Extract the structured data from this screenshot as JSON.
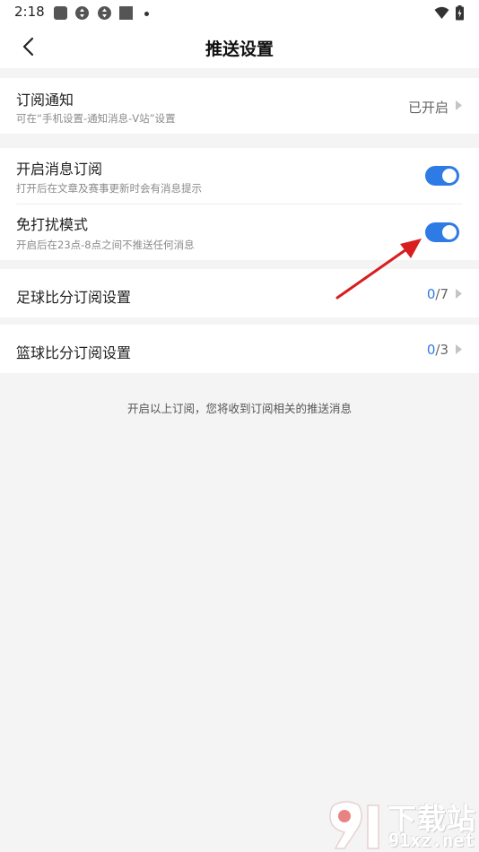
{
  "status_bar": {
    "time": "2:18",
    "icons": [
      "app-notification-icon",
      "sync-icon",
      "sync-icon",
      "stop-icon",
      "dot-icon",
      "wifi-icon",
      "battery-charging-icon"
    ]
  },
  "header": {
    "title": "推送设置",
    "back_icon": "chevron-left-icon"
  },
  "subscription_notice": {
    "title": "订阅通知",
    "subtitle": "可在“手机设置-通知消息-V站”设置",
    "status": "已开启"
  },
  "message_subscription": {
    "title": "开启消息订阅",
    "subtitle": "打开后在文章及赛事更新时会有消息提示",
    "enabled": true
  },
  "do_not_disturb": {
    "title": "免打扰模式",
    "subtitle": "开启后在23点-8点之间不推送任何消息",
    "enabled": true
  },
  "football_scores": {
    "title": "足球比分订阅设置",
    "count": "0",
    "total": "/7"
  },
  "basketball_scores": {
    "title": "篮球比分订阅设置",
    "count": "0",
    "total": "/3"
  },
  "footer": {
    "note": "开启以上订阅，您将收到订阅相关的推送消息"
  },
  "watermark": {
    "top": "下载站",
    "bottom": "91xz.net"
  },
  "colors": {
    "accent": "#2f7be5",
    "background": "#f4f4f4",
    "annotation": "#e02020"
  }
}
